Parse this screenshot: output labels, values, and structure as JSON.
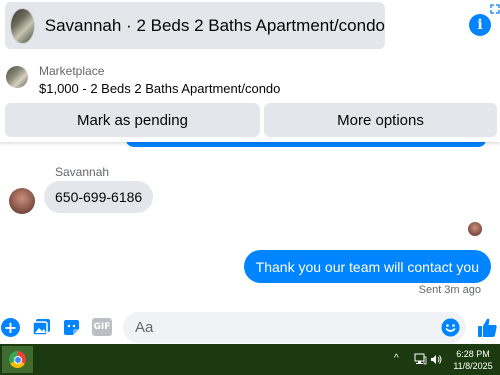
{
  "header": {
    "title": "Savannah · 2 Beds 2 Baths Apartment/condo",
    "info_icon": "info-circle-icon",
    "expand_icon": "expand-icon"
  },
  "marketplace": {
    "label": "Marketplace",
    "listing": "$1,000 - 2 Beds 2 Baths Apartment/condo",
    "mark_pending_label": "Mark as pending",
    "more_options_label": "More options"
  },
  "chat": {
    "sender_name": "Savannah",
    "incoming_message": "650-699-6186",
    "outgoing_message": "Thank you our team will contact you",
    "sent_status": "Sent 3m ago"
  },
  "composer": {
    "placeholder": "Aa",
    "gif_label": "GIF",
    "plus_label": "+"
  },
  "taskbar": {
    "time": "6:28 PM",
    "date": "11/8/2025",
    "tray_expand": "^"
  },
  "colors": {
    "accent": "#0084ff",
    "bubble_incoming": "#e4e6eb",
    "taskbar_bg": "#1c3a0f"
  }
}
